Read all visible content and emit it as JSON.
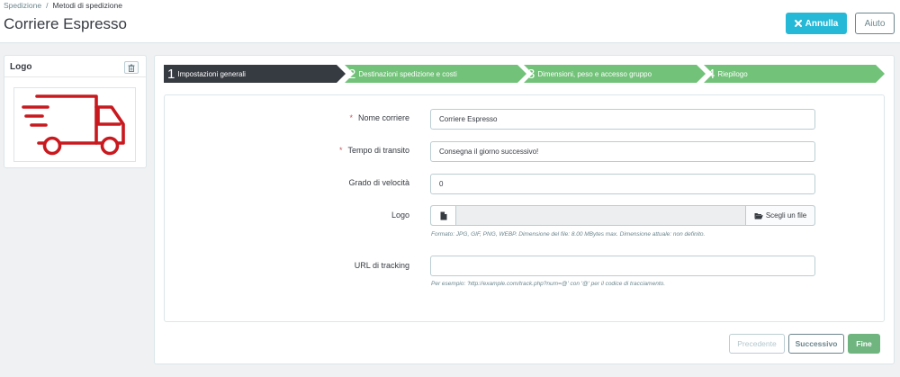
{
  "breadcrumb": {
    "parent": "Spedizione",
    "separator": "/",
    "current": "Metodi di spedizione"
  },
  "page": {
    "title": "Corriere Espresso"
  },
  "header_buttons": {
    "cancel_label": "Annulla",
    "help_label": "Aiuto"
  },
  "logo_panel": {
    "title": "Logo",
    "image_icon": "delivery-truck-icon",
    "icon_color": "#c8191f"
  },
  "wizard": {
    "steps": [
      {
        "number": "1",
        "label": "Impostazioni generali",
        "state": "active"
      },
      {
        "number": "2",
        "label": "Destinazioni spedizione e costi",
        "state": "inactive"
      },
      {
        "number": "3",
        "label": "Dimensioni, peso e accesso gruppo",
        "state": "inactive"
      },
      {
        "number": "4",
        "label": "Riepilogo",
        "state": "inactive"
      }
    ],
    "active_color": "#363a41",
    "inactive_color": "#72c279"
  },
  "form": {
    "carrier_name": {
      "label": "Nome corriere",
      "required_mark": "*",
      "value": "Corriere Espresso"
    },
    "transit_time": {
      "label": "Tempo di transito",
      "required_mark": "*",
      "value": "Consegna il giorno successivo!"
    },
    "speed_grade": {
      "label": "Grado di velocità",
      "value": "0"
    },
    "logo": {
      "label": "Logo",
      "file_value": "",
      "choose_label": "Scegli un file",
      "help": "Formato: JPG, GIF, PNG, WEBP. Dimensione del file: 8.00 MBytes max. Dimensione attuale: non definito."
    },
    "tracking_url": {
      "label": "URL di tracking",
      "value": "",
      "help": "Per esempio: 'http://example.com/track.php?num=@' con '@' per il codice di tracciamento."
    }
  },
  "footer_buttons": {
    "previous_label": "Precedente",
    "next_label": "Successivo",
    "finish_label": "Fine"
  },
  "colors": {
    "primary": "#25b9d7",
    "success": "#70b580",
    "required": "#c05c67"
  }
}
